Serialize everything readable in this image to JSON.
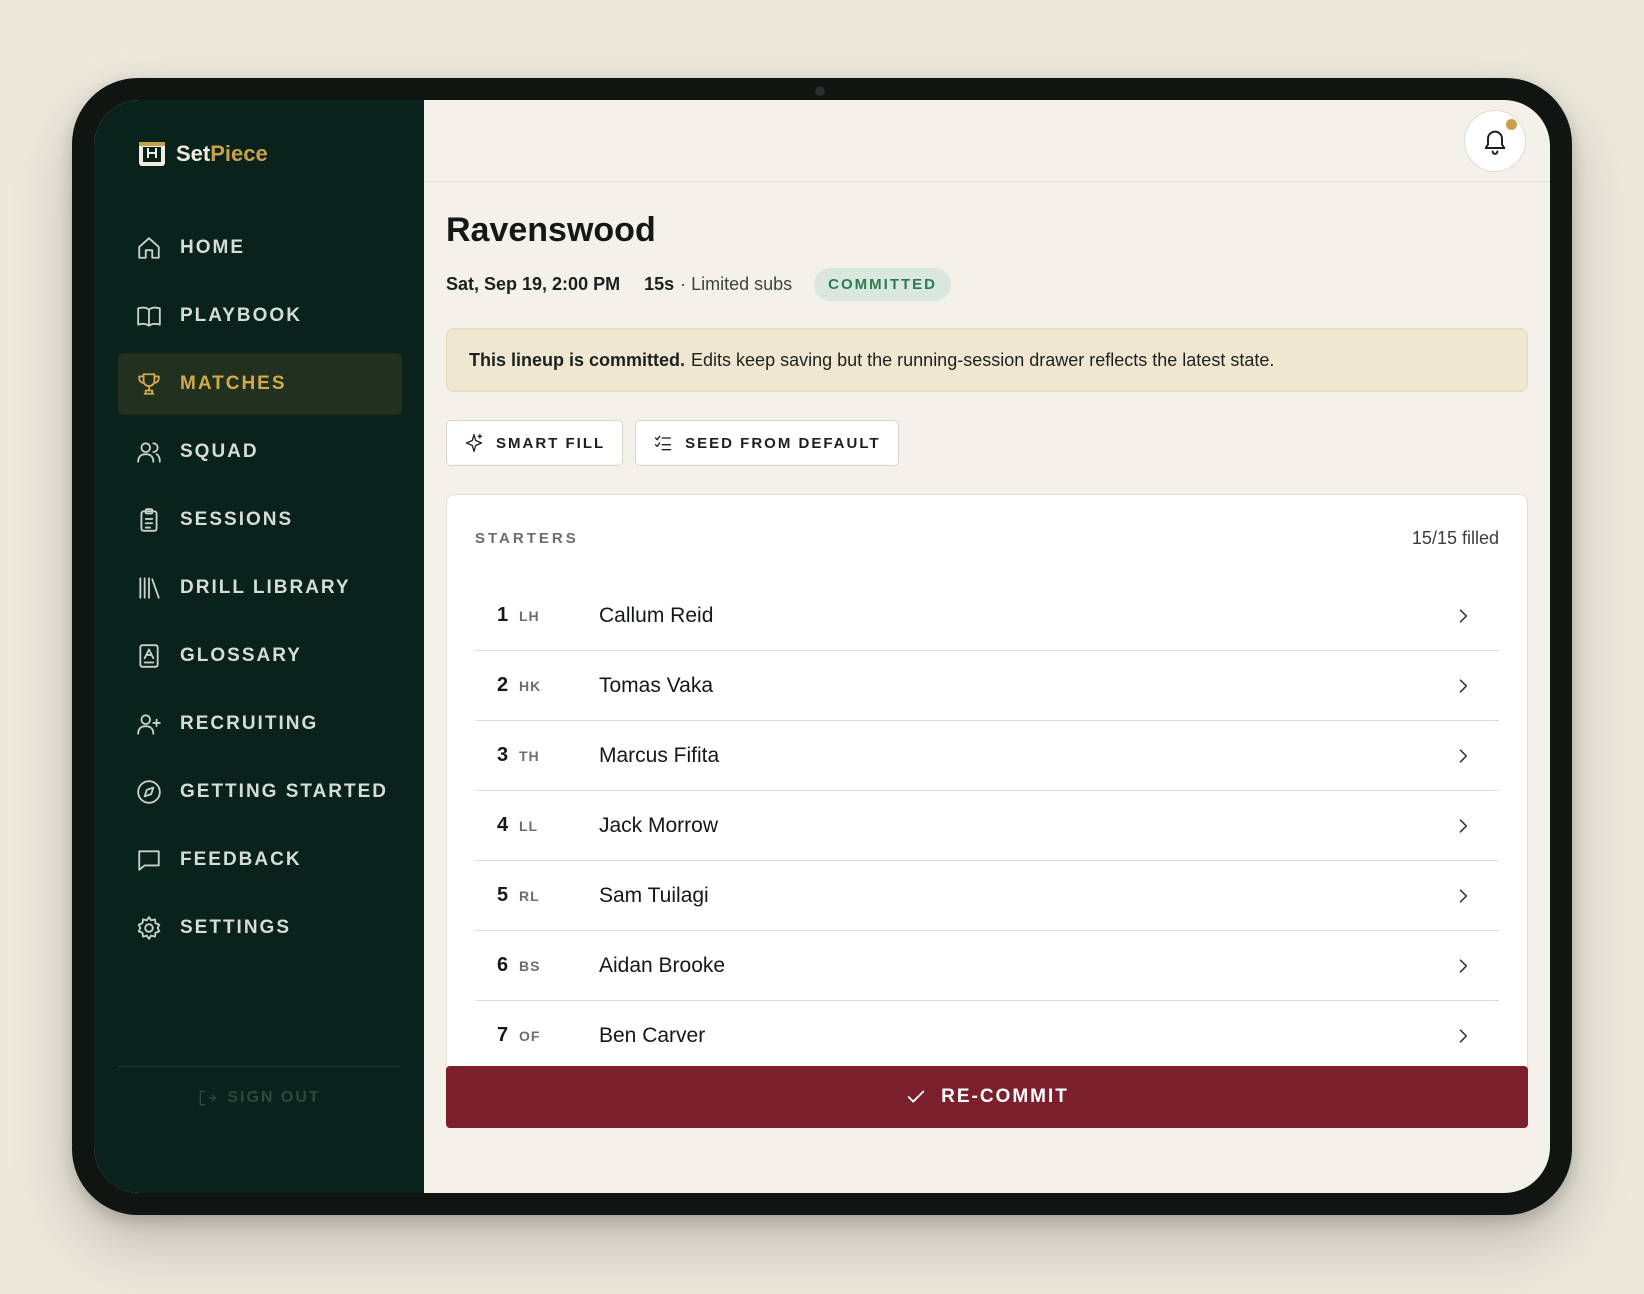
{
  "brand": {
    "name_a": "Set",
    "name_b": "Piece"
  },
  "sidebar": {
    "items": [
      {
        "label": "HOME",
        "icon": "home-icon"
      },
      {
        "label": "PLAYBOOK",
        "icon": "book-icon"
      },
      {
        "label": "MATCHES",
        "icon": "trophy-icon",
        "active": true
      },
      {
        "label": "SQUAD",
        "icon": "users-icon"
      },
      {
        "label": "SESSIONS",
        "icon": "clipboard-icon"
      },
      {
        "label": "DRILL LIBRARY",
        "icon": "library-icon"
      },
      {
        "label": "GLOSSARY",
        "icon": "glossary-icon"
      },
      {
        "label": "RECRUITING",
        "icon": "user-plus-icon"
      },
      {
        "label": "GETTING STARTED",
        "icon": "compass-icon"
      },
      {
        "label": "FEEDBACK",
        "icon": "message-icon"
      },
      {
        "label": "SETTINGS",
        "icon": "gear-icon"
      }
    ],
    "sign_out": "SIGN OUT"
  },
  "match": {
    "title": "Ravenswood",
    "date": "Sat, Sep 19, 2:00 PM",
    "format": "15s",
    "subs": "· Limited subs",
    "status": "COMMITTED"
  },
  "notice": {
    "strong": "This lineup is committed.",
    "text": "Edits keep saving but the running-session drawer reflects the latest state."
  },
  "actions": {
    "smart_fill": "SMART FILL",
    "seed_default": "SEED FROM DEFAULT"
  },
  "starters": {
    "label": "STARTERS",
    "count": "15/15 filled",
    "rows": [
      {
        "num": "1",
        "pos": "LH",
        "name": "Callum Reid"
      },
      {
        "num": "2",
        "pos": "HK",
        "name": "Tomas Vaka"
      },
      {
        "num": "3",
        "pos": "TH",
        "name": "Marcus Fifita"
      },
      {
        "num": "4",
        "pos": "LL",
        "name": "Jack Morrow"
      },
      {
        "num": "5",
        "pos": "RL",
        "name": "Sam Tuilagi"
      },
      {
        "num": "6",
        "pos": "BS",
        "name": "Aidan Brooke"
      },
      {
        "num": "7",
        "pos": "OF",
        "name": "Ben Carver"
      }
    ]
  },
  "recommit": "RE-COMMIT",
  "colors": {
    "sidebar": "#0a221c",
    "accent": "#c9a04a",
    "primary_button": "#7b1f2d",
    "badge_text": "#2c7a52"
  }
}
